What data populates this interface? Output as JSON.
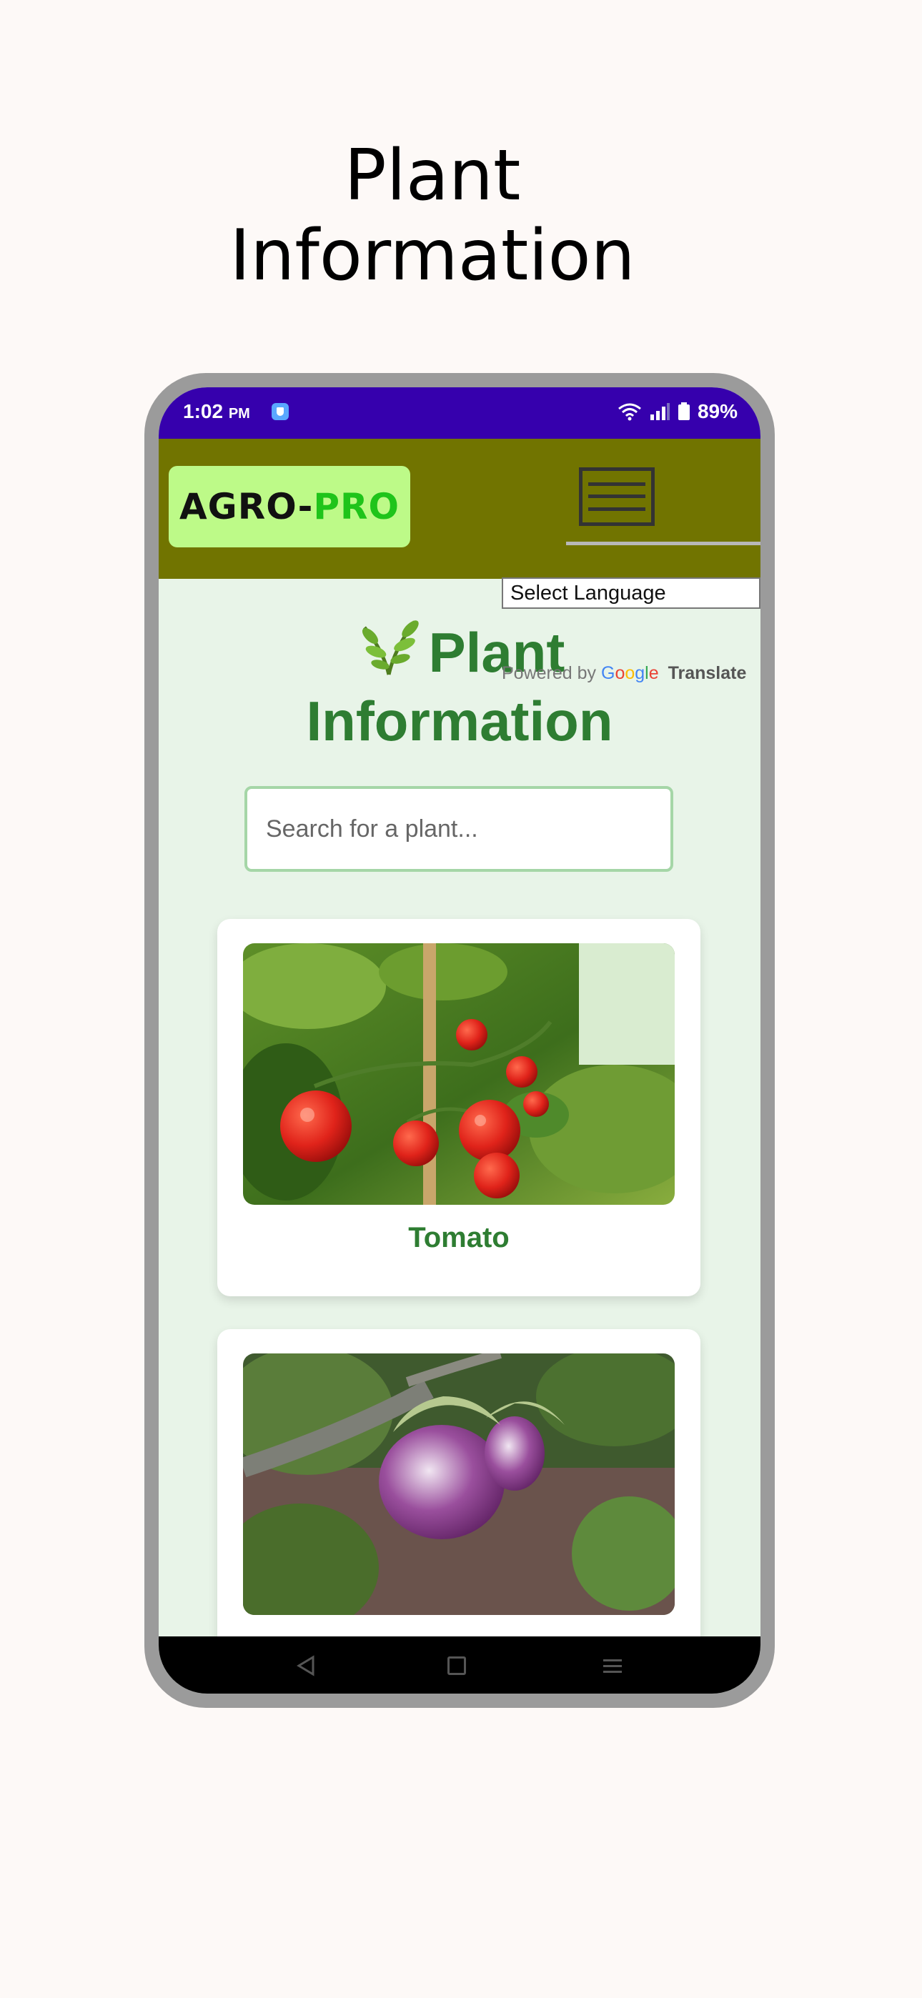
{
  "page_heading": {
    "line1": "Plant",
    "line2": "Information"
  },
  "status_bar": {
    "time": "1:02",
    "ampm": "PM",
    "battery": "89%"
  },
  "header": {
    "logo_part1": "AGRO-",
    "logo_part2": "PRO"
  },
  "translate": {
    "select_label": "Select Language",
    "powered_by": "Powered by",
    "google": [
      "G",
      "o",
      "o",
      "g",
      "l",
      "e"
    ],
    "translate_word": "Translate"
  },
  "main": {
    "title_line1": "Plant",
    "title_line2": "Information",
    "search_placeholder": "Search for a plant..."
  },
  "plants": [
    {
      "name": "Tomato"
    },
    {
      "name": ""
    }
  ],
  "colors": {
    "status_bar": "#3600ad",
    "header": "#717400",
    "logo_bg": "#bdfa88",
    "accent_green": "#2e7d32",
    "page_bg": "#e8f4e8"
  },
  "icons": [
    "shield-icon",
    "wifi-icon",
    "signal-icon",
    "battery-icon",
    "menu-icon",
    "leaf-icon",
    "back-icon",
    "home-icon",
    "recents-icon"
  ]
}
